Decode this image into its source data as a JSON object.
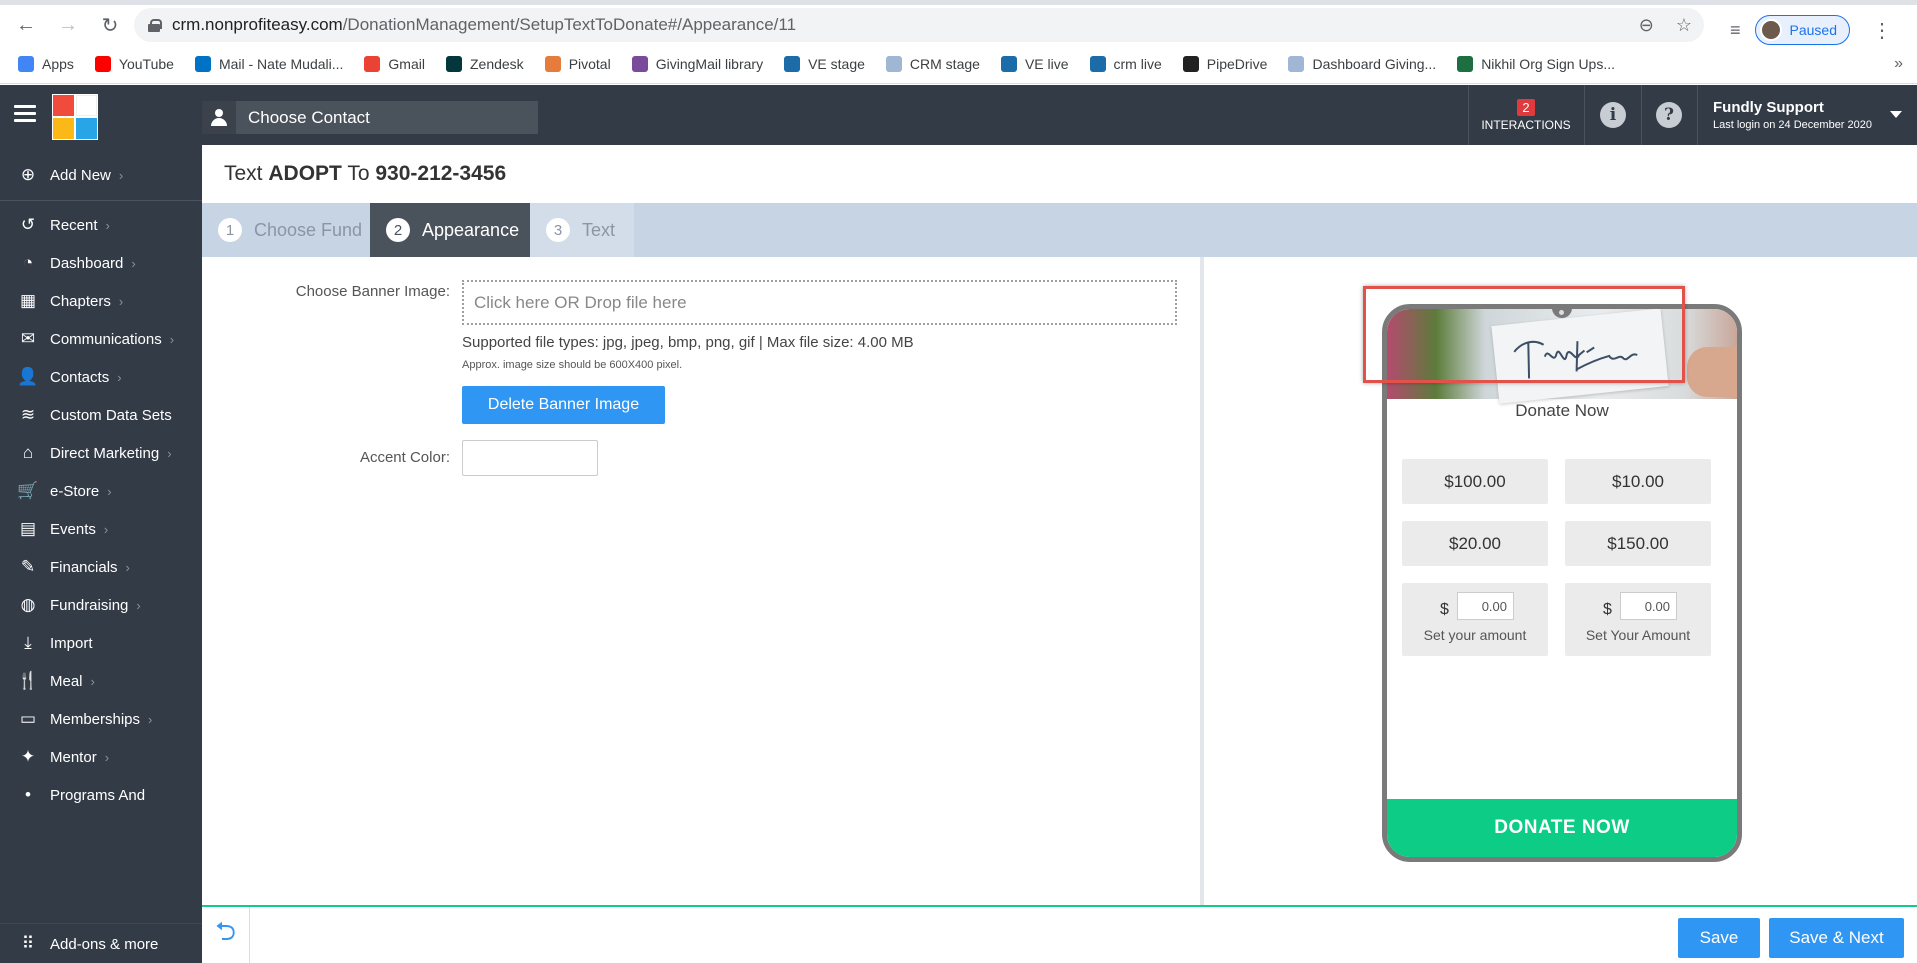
{
  "browser": {
    "url_host": "crm.nonprofiteasy.com",
    "url_path": "/DonationManagement/SetupTextToDonate#/Appearance/11",
    "profile_status": "Paused",
    "bookmarks": [
      {
        "label": "Apps",
        "icon": "apps-grid-icon",
        "color": "#4285f4"
      },
      {
        "label": "YouTube",
        "icon": "youtube-icon",
        "color": "#ff0000"
      },
      {
        "label": "Mail - Nate Mudali...",
        "icon": "outlook-icon",
        "color": "#0072c6"
      },
      {
        "label": "Gmail",
        "icon": "google-icon",
        "color": "#ea4335"
      },
      {
        "label": "Zendesk",
        "icon": "zendesk-icon",
        "color": "#03363d"
      },
      {
        "label": "Pivotal",
        "icon": "pivotal-icon",
        "color": "#e57c3b"
      },
      {
        "label": "GivingMail library",
        "icon": "givingmail-icon",
        "color": "#7b4a9a"
      },
      {
        "label": "VE stage",
        "icon": "ve-icon",
        "color": "#1b6ca8"
      },
      {
        "label": "CRM stage",
        "icon": "doc-icon",
        "color": "#9fb7d5"
      },
      {
        "label": "VE live",
        "icon": "ve-icon",
        "color": "#1b6ca8"
      },
      {
        "label": "crm live",
        "icon": "ve-icon",
        "color": "#1b6ca8"
      },
      {
        "label": "PipeDrive",
        "icon": "pipedrive-icon",
        "color": "#222222"
      },
      {
        "label": "Dashboard Giving...",
        "icon": "doc-icon",
        "color": "#9fb7d5"
      },
      {
        "label": "Nikhil Org Sign Ups...",
        "icon": "excel-icon",
        "color": "#1d6f42"
      }
    ],
    "more_glyph": "»"
  },
  "header": {
    "choose_contact": "Choose Contact",
    "interactions_count": "2",
    "interactions_label": "INTERACTIONS",
    "user_name": "Fundly Support",
    "last_login": "Last login on 24 December 2020"
  },
  "sidebar": {
    "add_new": "Add New",
    "items": [
      {
        "label": "Recent",
        "icon": "history-icon",
        "glyph": "↺",
        "chevron": true
      },
      {
        "label": "Dashboard",
        "icon": "dashboard-icon",
        "glyph": "◔",
        "chevron": true
      },
      {
        "label": "Chapters",
        "icon": "grid-icon",
        "glyph": "▦",
        "chevron": true
      },
      {
        "label": "Communications",
        "icon": "envelope-icon",
        "glyph": "✉",
        "chevron": true
      },
      {
        "label": "Contacts",
        "icon": "person-icon",
        "glyph": "👤",
        "chevron": true
      },
      {
        "label": "Custom Data Sets",
        "icon": "layers-icon",
        "glyph": "≋",
        "chevron": false
      },
      {
        "label": "Direct Marketing",
        "icon": "bank-icon",
        "glyph": "⌂",
        "chevron": true
      },
      {
        "label": "e-Store",
        "icon": "cart-icon",
        "glyph": "🛒",
        "chevron": true
      },
      {
        "label": "Events",
        "icon": "calendar-icon",
        "glyph": "▤",
        "chevron": true
      },
      {
        "label": "Financials",
        "icon": "money-icon",
        "glyph": "✎",
        "chevron": true
      },
      {
        "label": "Fundraising",
        "icon": "moneybag-icon",
        "glyph": "◍",
        "chevron": true
      },
      {
        "label": "Import",
        "icon": "download-icon",
        "glyph": "⤓",
        "chevron": false
      },
      {
        "label": "Meal",
        "icon": "cutlery-icon",
        "glyph": "🍴",
        "chevron": true
      },
      {
        "label": "Memberships",
        "icon": "id-card-icon",
        "glyph": "▭",
        "chevron": true
      },
      {
        "label": "Mentor",
        "icon": "mentor-icon",
        "glyph": "✦",
        "chevron": true
      },
      {
        "label": "Programs And",
        "icon": "programs-icon",
        "glyph": "•",
        "chevron": false
      }
    ],
    "addons": "Add-ons & more"
  },
  "page": {
    "title_prefix": "Text",
    "keyword": "ADOPT",
    "title_mid": "To",
    "phone": "930-212-3456"
  },
  "steps": [
    {
      "num": "1",
      "label": "Choose Fund"
    },
    {
      "num": "2",
      "label": "Appearance"
    },
    {
      "num": "3",
      "label": "Text"
    }
  ],
  "form": {
    "banner_label": "Choose Banner Image:",
    "dropzone_text": "Click here OR Drop file here",
    "supported_types": "Supported file types: jpg, jpeg, bmp, png, gif | Max file size: 4.00 MB",
    "size_hint": "Approx. image size should be 600X400 pixel.",
    "delete_banner": "Delete Banner Image",
    "accent_label": "Accent Color:",
    "accent_value": ""
  },
  "preview": {
    "banner_text": "Thank you",
    "donate_title": "Donate Now",
    "amounts": [
      "$100.00",
      "$10.00",
      "$20.00",
      "$150.00"
    ],
    "custom": [
      {
        "currency": "$",
        "value": "0.00",
        "label": "Set your amount"
      },
      {
        "currency": "$",
        "value": "0.00",
        "label": "Set Your Amount"
      }
    ],
    "donate_button": "DONATE NOW",
    "accent_color": "#0dcc85"
  },
  "footer": {
    "save": "Save",
    "save_next": "Save & Next"
  }
}
